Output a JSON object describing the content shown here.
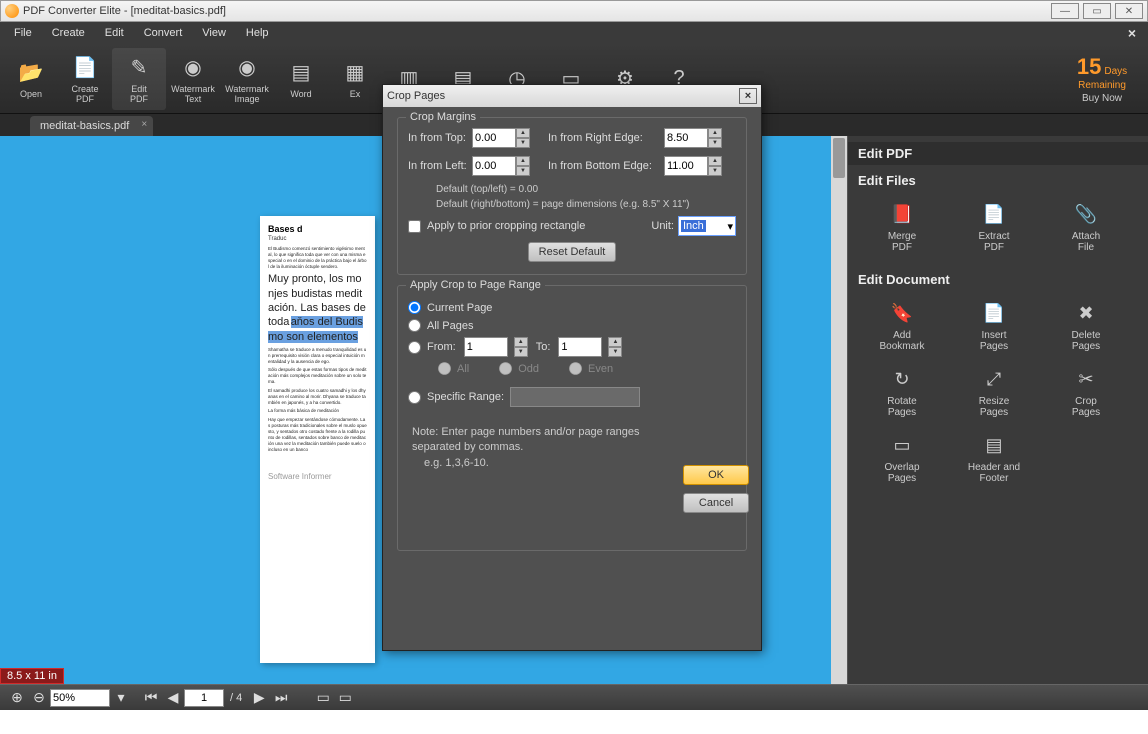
{
  "titlebar": {
    "app": "PDF Converter Elite",
    "file": "[meditat-basics.pdf]"
  },
  "menu": {
    "file": "File",
    "create": "Create",
    "edit": "Edit",
    "convert": "Convert",
    "view": "View",
    "help": "Help"
  },
  "toolbar": {
    "open": "Open",
    "createpdf": "Create\nPDF",
    "editpdf": "Edit\nPDF",
    "wmtext": "Watermark\nText",
    "wmimage": "Watermark\nImage",
    "word": "Word",
    "ex": "Ex"
  },
  "trial": {
    "days": "15",
    "dayslbl": "Days",
    "remaining": "Remaining",
    "buy": "Buy Now"
  },
  "tab": {
    "name": "meditat-basics.pdf"
  },
  "sizebadge": "8.5 x 11 in",
  "sidebar": {
    "title": "Edit PDF",
    "files": "Edit Files",
    "filesItems": [
      {
        "label": "Merge\nPDF"
      },
      {
        "label": "Extract\nPDF"
      },
      {
        "label": "Attach\nFile"
      }
    ],
    "doc": "Edit Document",
    "docItems": [
      {
        "label": "Add\nBookmark"
      },
      {
        "label": "Insert\nPages"
      },
      {
        "label": "Delete\nPages"
      },
      {
        "label": "Rotate\nPages"
      },
      {
        "label": "Resize\nPages"
      },
      {
        "label": "Crop\nPages"
      },
      {
        "label": "Overlap\nPages"
      },
      {
        "label": "Header and\nFooter"
      }
    ]
  },
  "bottom": {
    "zoom": "50%",
    "page": "1",
    "total": "/ 4"
  },
  "dialog": {
    "title": "Crop Pages",
    "margins": "Crop Margins",
    "top": "In from Top:",
    "topv": "0.00",
    "left": "In from Left:",
    "leftv": "0.00",
    "right": "In from Right Edge:",
    "rightv": "8.50",
    "bottom": "In from Bottom Edge:",
    "bottomv": "11.00",
    "def1": "Default (top/left) = 0.00",
    "def2": "Default (right/bottom) = page dimensions (e.g. 8.5\" X 11\")",
    "apply": "Apply to prior cropping rectangle",
    "unit": "Unit:",
    "unitv": "Inch",
    "reset": "Reset Default",
    "range": "Apply Crop to Page Range",
    "current": "Current Page",
    "all": "All Pages",
    "from": "From:",
    "fromv": "1",
    "to": "To:",
    "tov": "1",
    "rall": "All",
    "rodd": "Odd",
    "reven": "Even",
    "specific": "Specific Range:",
    "ok": "OK",
    "cancel": "Cancel",
    "note1": "Note: Enter page numbers and/or page ranges",
    "note2": "separated by commas.",
    "note3": "e.g. 1,3,6-10."
  },
  "page": {
    "title": "Bases d",
    "sub": "Traduc",
    "p1": "El Budismo comenzó sentimiento vigésimo mental, lo que significa toda que ver con una misma especial o en el dominio de la práctica bajo el árbol de la iluminación óctuple sendero.",
    "p2": "Muy pronto, los monjes budistas meditación. Las bases de toda",
    "hl": "aňos del Budismo son elementos",
    "p3": "Shamatha se traduce a menudo tranquilidad es un prerrequisito visión clara o especial intuición mentalidad y la ausencia de ego.",
    "p4": "Sólo después de que estas formas tipos de meditación más complejos meditación sobre un solo tema.",
    "p5": "El samadhi produce los cuatro samadhi y los dhyanas en el camino al morir. Dhyana se traduce también en japonés, y a ha convertido.",
    "p6": "La forma más básica de meditación",
    "p7": "Hay que empezar sentándose cómodamente. Las posturas más tradicionales sobre el muslo opuesto, y sentados otro costado frente a la rodilla punto de rodillas, sentados sobre banco de meditación una vez la meditación también puede suelo o incluso en un banco",
    "wm": "Software Informer"
  }
}
